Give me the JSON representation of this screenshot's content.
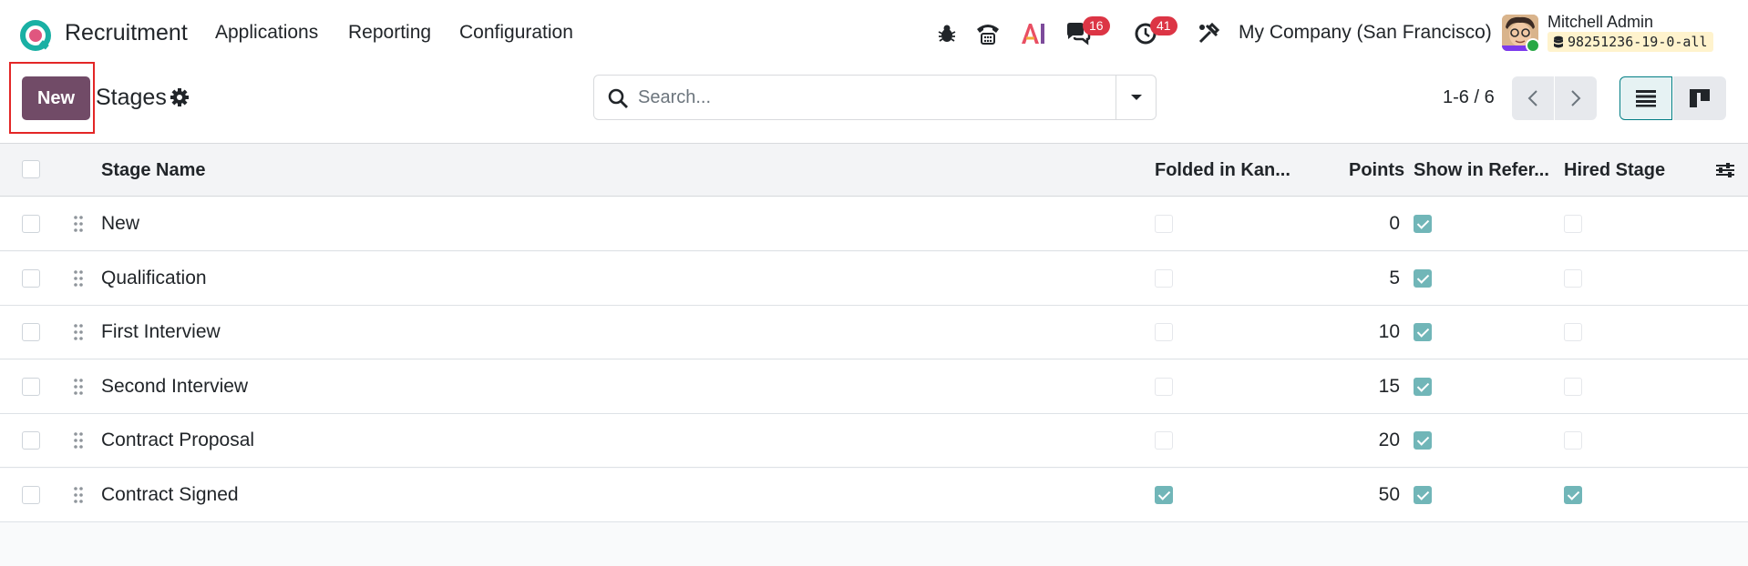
{
  "navbar": {
    "app_name": "Recruitment",
    "menu": [
      "Applications",
      "Reporting",
      "Configuration"
    ],
    "messages_count": "16",
    "activities_count": "41",
    "company": "My Company (San Francisco)",
    "user_name": "Mitchell Admin",
    "database": "98251236-19-0-all"
  },
  "control": {
    "new_label": "New",
    "breadcrumb": "Stages",
    "search_placeholder": "Search...",
    "pager": "1-6 / 6"
  },
  "table": {
    "columns": {
      "name": "Stage Name",
      "folded": "Folded in Kan...",
      "points": "Points",
      "referral": "Show in Refer...",
      "hired": "Hired Stage"
    },
    "rows": [
      {
        "name": "New",
        "folded": false,
        "points": "0",
        "referral": true,
        "hired": false
      },
      {
        "name": "Qualification",
        "folded": false,
        "points": "5",
        "referral": true,
        "hired": false
      },
      {
        "name": "First Interview",
        "folded": false,
        "points": "10",
        "referral": true,
        "hired": false
      },
      {
        "name": "Second Interview",
        "folded": false,
        "points": "15",
        "referral": true,
        "hired": false
      },
      {
        "name": "Contract Proposal",
        "folded": false,
        "points": "20",
        "referral": true,
        "hired": false
      },
      {
        "name": "Contract Signed",
        "folded": true,
        "points": "50",
        "referral": true,
        "hired": true
      }
    ]
  },
  "colors": {
    "brand": "#714b67",
    "check": "#71b6b8",
    "badge": "#dc3545"
  }
}
